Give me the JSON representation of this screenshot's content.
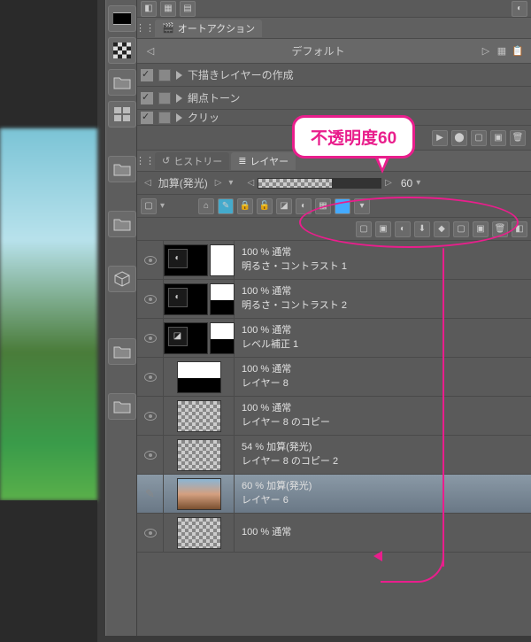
{
  "callout_text": "不透明度60",
  "auto_action": {
    "tab_label": "オートアクション",
    "dropdown_label": "デフォルト",
    "items": [
      {
        "label": "下描きレイヤーの作成"
      },
      {
        "label": "網点トーン"
      },
      {
        "label": "クリッ"
      }
    ]
  },
  "panel_tabs": {
    "history": "ヒストリー",
    "layers": "レイヤー"
  },
  "blend": {
    "mode": "加算(発光)",
    "opacity": "60"
  },
  "layers": [
    {
      "line1": "100 % 通常",
      "line2": "明るさ・コントラスト 1",
      "adj": "◐",
      "mask": true
    },
    {
      "line1": "100 % 通常",
      "line2": "明るさ・コントラスト 2",
      "adj": "◐",
      "mask": true,
      "mask_grass": true
    },
    {
      "line1": "100 % 通常",
      "line2": "レベル補正 1",
      "adj": "◪",
      "mask": true,
      "mask_grass": true
    },
    {
      "line1": "100 % 通常",
      "line2": "レイヤー 8",
      "grass": true
    },
    {
      "line1": "100 % 通常",
      "line2": "レイヤー 8 のコピー"
    },
    {
      "line1": "54 % 加算(発光)",
      "line2": "レイヤー 8 のコピー 2"
    },
    {
      "line1": "60 % 加算(発光)",
      "line2": "レイヤー 6",
      "photo": true,
      "selected": true
    },
    {
      "line1": "100 % 通常",
      "line2": ""
    }
  ]
}
